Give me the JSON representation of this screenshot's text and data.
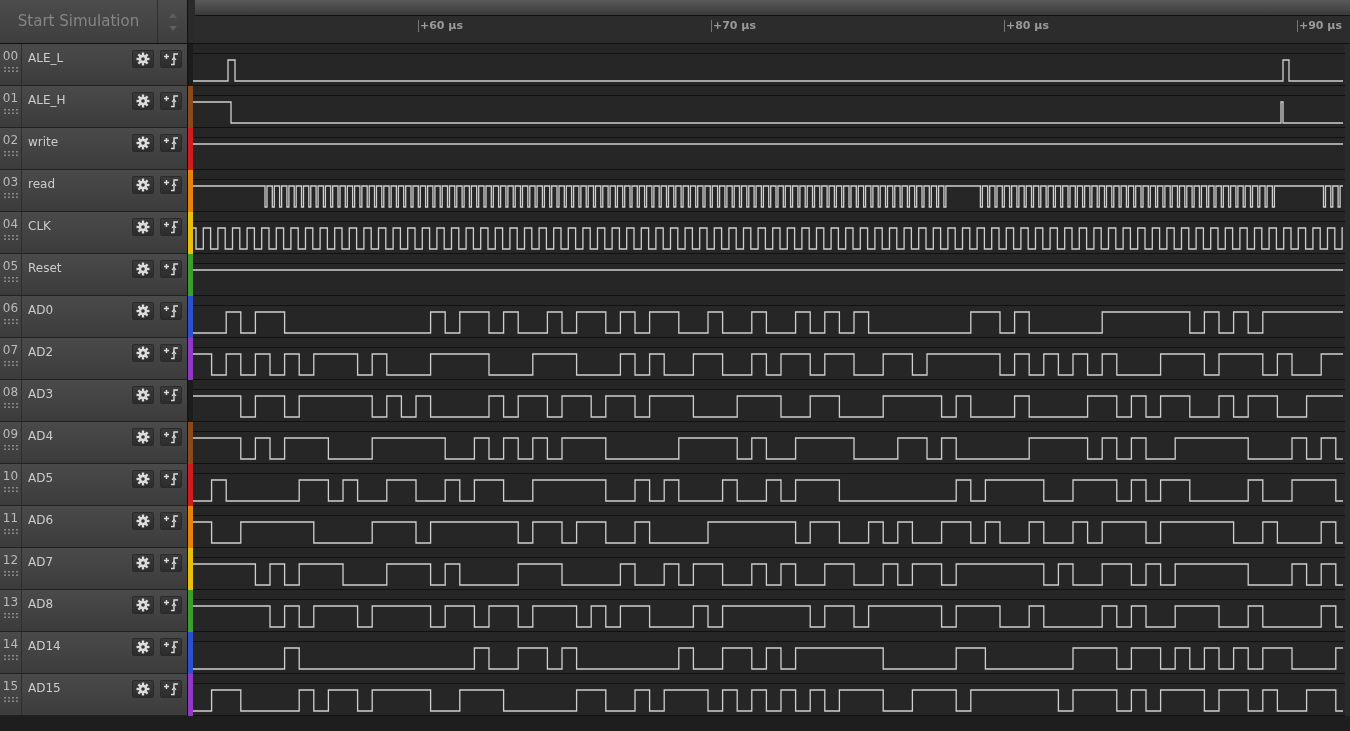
{
  "toolbar": {
    "start_button": {
      "label": "Start Simulation",
      "disabled": true
    }
  },
  "timeline": {
    "ticks": [
      "+60 µs",
      "+70 µs",
      "+80 µs",
      "+90 µs"
    ]
  },
  "channels": [
    {
      "number": "00",
      "name": "ALE_L",
      "color": "#1c1c1c",
      "kind": "strobe"
    },
    {
      "number": "01",
      "name": "ALE_H",
      "color": "#8a4a1c",
      "kind": "latch"
    },
    {
      "number": "02",
      "name": "write",
      "color": "#d01c1c",
      "kind": "idle"
    },
    {
      "number": "03",
      "name": "read",
      "color": "#e8820c",
      "kind": "burst"
    },
    {
      "number": "04",
      "name": "CLK",
      "color": "#e8c00c",
      "kind": "clock"
    },
    {
      "number": "05",
      "name": "Reset",
      "color": "#3c9c2c",
      "kind": "idle"
    },
    {
      "number": "06",
      "name": "AD0",
      "color": "#2c50d0",
      "kind": "data"
    },
    {
      "number": "07",
      "name": "AD2",
      "color": "#9038c8",
      "kind": "data"
    },
    {
      "number": "08",
      "name": "AD3",
      "color": "#1c1c1c",
      "kind": "data"
    },
    {
      "number": "09",
      "name": "AD4",
      "color": "#8a4a1c",
      "kind": "data"
    },
    {
      "number": "10",
      "name": "AD5",
      "color": "#d01c1c",
      "kind": "data"
    },
    {
      "number": "11",
      "name": "AD6",
      "color": "#e8820c",
      "kind": "data"
    },
    {
      "number": "12",
      "name": "AD7",
      "color": "#e8c00c",
      "kind": "data"
    },
    {
      "number": "13",
      "name": "AD8",
      "color": "#3c9c2c",
      "kind": "data"
    },
    {
      "number": "14",
      "name": "AD14",
      "color": "#2c50d0",
      "kind": "data"
    },
    {
      "number": "15",
      "name": "AD15",
      "color": "#9038c8",
      "kind": "data"
    }
  ]
}
